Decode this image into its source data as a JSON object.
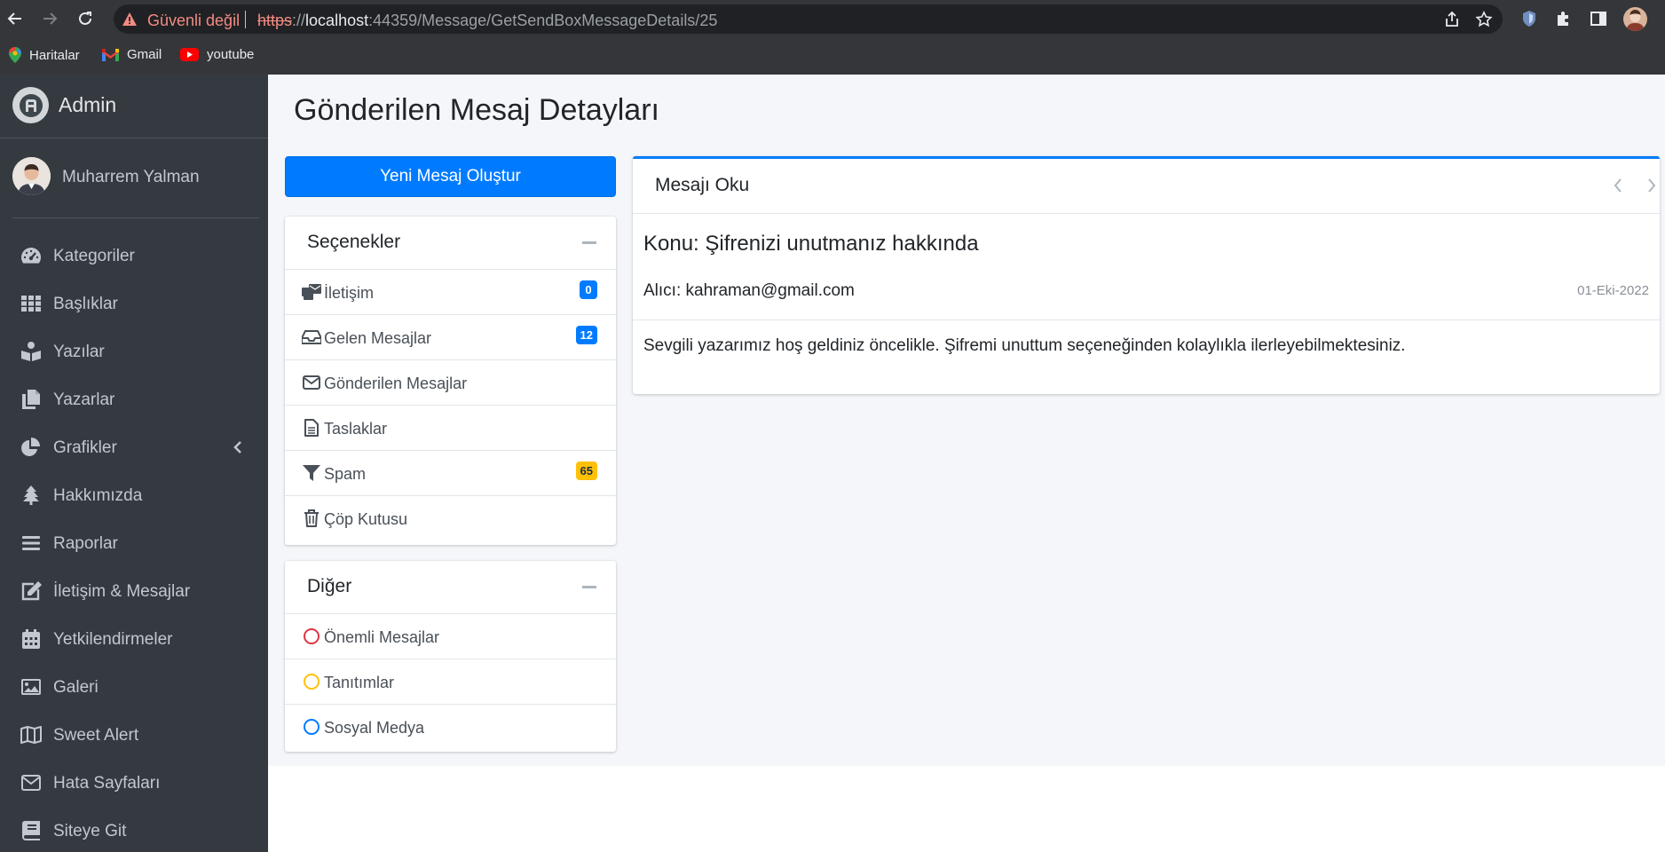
{
  "browser": {
    "security_label": "Güvenli değil",
    "url_scheme": "https",
    "url_separator": "://",
    "url_host": "localhost",
    "url_rest": ":44359/Message/GetSendBoxMessageDetails/25",
    "bookmarks": [
      {
        "label": "Haritalar",
        "icon": "maps-icon"
      },
      {
        "label": "Gmail",
        "icon": "gmail-icon"
      },
      {
        "label": "youtube",
        "icon": "youtube-icon"
      }
    ]
  },
  "sidebar": {
    "brand": "Admin",
    "user": "Muharrem Yalman",
    "items": [
      {
        "label": "Kategoriler",
        "icon": "tachometer-icon"
      },
      {
        "label": "Başlıklar",
        "icon": "grid-icon"
      },
      {
        "label": "Yazılar",
        "icon": "book-reader-icon"
      },
      {
        "label": "Yazarlar",
        "icon": "copy-icon"
      },
      {
        "label": "Grafikler",
        "icon": "pie-chart-icon"
      },
      {
        "label": "Hakkımızda",
        "icon": "tree-icon"
      },
      {
        "label": "Raporlar",
        "icon": "bars-icon"
      },
      {
        "label": "İletişim & Mesajlar",
        "icon": "edit-icon"
      },
      {
        "label": "Yetkilendirmeler",
        "icon": "calendar-icon"
      },
      {
        "label": "Galeri",
        "icon": "image-icon"
      },
      {
        "label": "Sweet Alert",
        "icon": "map-icon"
      },
      {
        "label": "Hata Sayfaları",
        "icon": "envelope-icon"
      },
      {
        "label": "Siteye Git",
        "icon": "book-icon"
      }
    ]
  },
  "main": {
    "page_title": "Gönderilen Mesaj Detayları",
    "compose_button": "Yeni Mesaj Oluştur",
    "options_card": {
      "title": "Seçenekler",
      "items": [
        {
          "label": "İletişim",
          "icon": "mail-bulk-icon",
          "badge": "0"
        },
        {
          "label": "Gelen Mesajlar",
          "icon": "inbox-icon",
          "badge": "12"
        },
        {
          "label": "Gönderilen Mesajlar",
          "icon": "envelope-outline-icon"
        },
        {
          "label": "Taslaklar",
          "icon": "file-alt-icon"
        },
        {
          "label": "Spam",
          "icon": "filter-icon",
          "badge": "65"
        },
        {
          "label": "Çöp Kutusu",
          "icon": "trash-icon"
        }
      ]
    },
    "other_card": {
      "title": "Diğer",
      "items": [
        {
          "label": "Önemli Mesajlar",
          "color": "#dc3545"
        },
        {
          "label": "Tanıtımlar",
          "color": "#ffc107"
        },
        {
          "label": "Sosyal Medya",
          "color": "#007bff"
        }
      ]
    },
    "message": {
      "card_title": "Mesajı Oku",
      "subject": "Konu: Şifrenizi unutmanız hakkında",
      "recipient": "Alıcı: kahraman@gmail.com",
      "date": "01-Eki-2022",
      "body": "Sevgili yazarımız hoş geldiniz öncelikle. Şifremi unuttum seçeneğinden kolaylıkla ilerleyebilmektesiniz."
    }
  },
  "colors": {
    "primary": "#007bff",
    "sidebar_bg": "#343a40",
    "content_bg": "#f4f6f9",
    "badge_warning": "#ffc107"
  }
}
